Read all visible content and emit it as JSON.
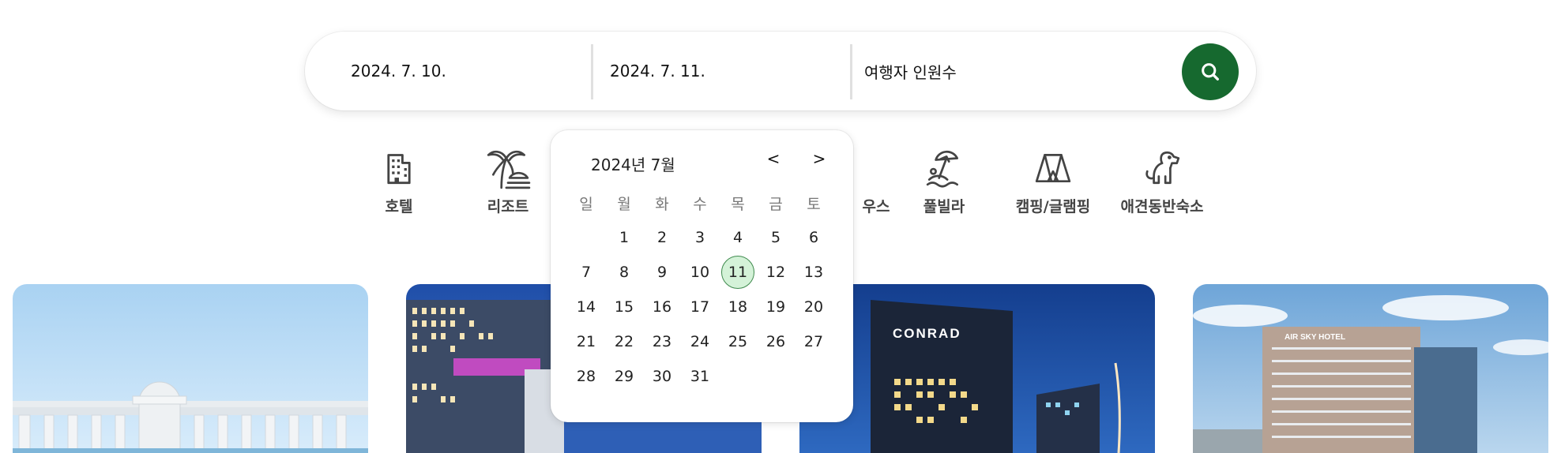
{
  "search": {
    "checkin": "2024. 7. 10.",
    "checkout": "2024. 7. 11.",
    "guests_placeholder": "여행자 인원수",
    "button_color": "#16692f"
  },
  "categories": [
    {
      "label": "호텔",
      "icon": "building-icon"
    },
    {
      "label": "리조트",
      "icon": "palm-tree-icon"
    },
    {
      "label": "우스",
      "icon": "house-icon"
    },
    {
      "label": "풀빌라",
      "icon": "beach-umbrella-icon"
    },
    {
      "label": "캠핑/글램핑",
      "icon": "tent-icon"
    },
    {
      "label": "애견동반숙소",
      "icon": "dog-icon"
    }
  ],
  "calendar": {
    "title": "2024년 7월",
    "prev": "<",
    "next": ">",
    "weekdays": [
      "일",
      "월",
      "화",
      "수",
      "목",
      "금",
      "토"
    ],
    "weeks": [
      [
        "",
        "1",
        "2",
        "3",
        "4",
        "5",
        "6"
      ],
      [
        "7",
        "8",
        "9",
        "10",
        "11",
        "12",
        "13"
      ],
      [
        "14",
        "15",
        "16",
        "17",
        "18",
        "19",
        "20"
      ],
      [
        "21",
        "22",
        "23",
        "24",
        "25",
        "26",
        "27"
      ],
      [
        "28",
        "29",
        "30",
        "31",
        "",
        "",
        ""
      ]
    ],
    "selected": "11",
    "selected_color": "#d4f2d8"
  },
  "cards": [
    {
      "name": "hotel-card-seaside"
    },
    {
      "name": "hotel-card-tower"
    },
    {
      "name": "hotel-card-conrad",
      "sign": "CONRAD"
    },
    {
      "name": "hotel-card-air-sky",
      "sign": "AIR SKY HOTEL"
    }
  ]
}
